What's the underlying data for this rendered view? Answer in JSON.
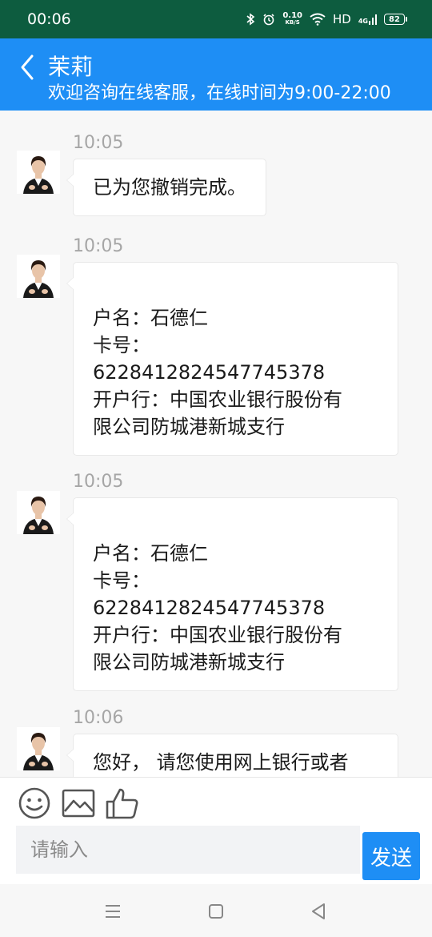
{
  "status_bar": {
    "time": "00:06",
    "speed_value": "0.10",
    "speed_unit": "KB/S",
    "hd": "HD",
    "network": "4G",
    "battery": "82",
    "icons": [
      "bluetooth-icon",
      "alarm-icon",
      "wifi-icon",
      "signal-icon",
      "battery-icon"
    ]
  },
  "header": {
    "title": "茉莉",
    "subtitle": "欢迎咨询在线客服，在线时间为9:00-22:00"
  },
  "messages": [
    {
      "time": "10:05",
      "lines": [
        "已为您撤销完成。"
      ]
    },
    {
      "time": "10:05",
      "lines": [
        "",
        "户名：石德仁",
        "卡号：",
        "6228412824547745378",
        "开户行：中国农业银行股份有",
        "限公司防城港新城支行"
      ]
    },
    {
      "time": "10:05",
      "lines": [
        "",
        "户名：石德仁",
        "卡号：",
        "6228412824547745378",
        "开户行：中国农业银行股份有",
        "限公司防城港新城支行"
      ]
    },
    {
      "time": "10:06",
      "lines": [
        "您好，  请您使用网上银行或者"
      ]
    }
  ],
  "input": {
    "placeholder": "请输入",
    "send_label": "发送",
    "tools": [
      "emoji-icon",
      "image-icon",
      "thumbs-up-icon"
    ]
  },
  "colors": {
    "status_bar": "#0d5c3f",
    "header": "#1e8ef5",
    "send_button": "#1e8ef5",
    "background": "#f7f7f7"
  }
}
